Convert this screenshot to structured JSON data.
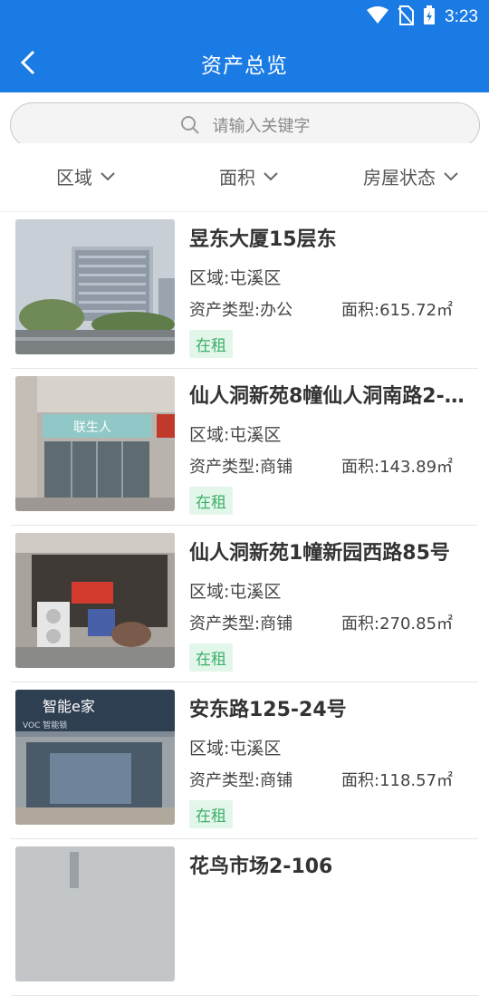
{
  "status": {
    "time": "3:23"
  },
  "header": {
    "title": "资产总览"
  },
  "search": {
    "placeholder": "请输入关键字"
  },
  "filters": [
    {
      "label": "区域"
    },
    {
      "label": "面积"
    },
    {
      "label": "房屋状态"
    }
  ],
  "items": [
    {
      "name": "昱东大厦15层东",
      "region": "区域:屯溪区",
      "type": "资产类型:办公",
      "area": "面积:615.72㎡",
      "status": "在租"
    },
    {
      "name": "仙人洞新苑8幢仙人洞南路2-…",
      "region": "区域:屯溪区",
      "type": "资产类型:商铺",
      "area": "面积:143.89㎡",
      "status": "在租"
    },
    {
      "name": "仙人洞新苑1幢新园西路85号",
      "region": "区域:屯溪区",
      "type": "资产类型:商铺",
      "area": "面积:270.85㎡",
      "status": "在租"
    },
    {
      "name": "安东路125-24号",
      "region": "区域:屯溪区",
      "type": "资产类型:商铺",
      "area": "面积:118.57㎡",
      "status": "在租"
    },
    {
      "name": "花鸟市场2-106",
      "region": "",
      "type": "",
      "area": "",
      "status": ""
    }
  ],
  "photo_text": {
    "shop1": "联生人",
    "shop3": "智能e家",
    "shop3b": "VOC 智能锁"
  },
  "colors": {
    "brand": "#1a7be5",
    "badge_text": "#3cb06a",
    "badge_bg": "#e3f6ea"
  }
}
